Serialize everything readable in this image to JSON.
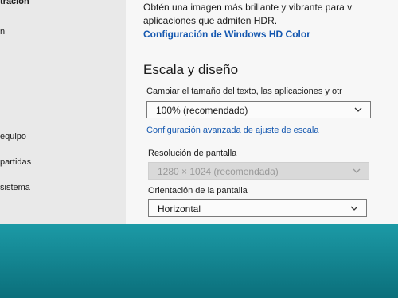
{
  "sidebar": {
    "items": [
      {
        "label": "tración"
      },
      {
        "label": "n"
      },
      {
        "label": "equipo"
      },
      {
        "label": "partidas"
      },
      {
        "label": "sistema"
      }
    ]
  },
  "hdr": {
    "line1": "Obtén una imagen más brillante y vibrante para v",
    "line2": "aplicaciones que admiten HDR.",
    "link": "Configuración de Windows HD Color"
  },
  "scale": {
    "title": "Escala y diseño",
    "desc": "Cambiar el tamaño del texto, las aplicaciones y otr",
    "dropdown_value": "100% (recomendado)",
    "advanced_link": "Configuración avanzada de ajuste de escala"
  },
  "resolution": {
    "label": "Resolución de pantalla",
    "value": "1280 × 1024 (recomendada)"
  },
  "orientation": {
    "label": "Orientación de la pantalla",
    "value": "Horizontal"
  }
}
